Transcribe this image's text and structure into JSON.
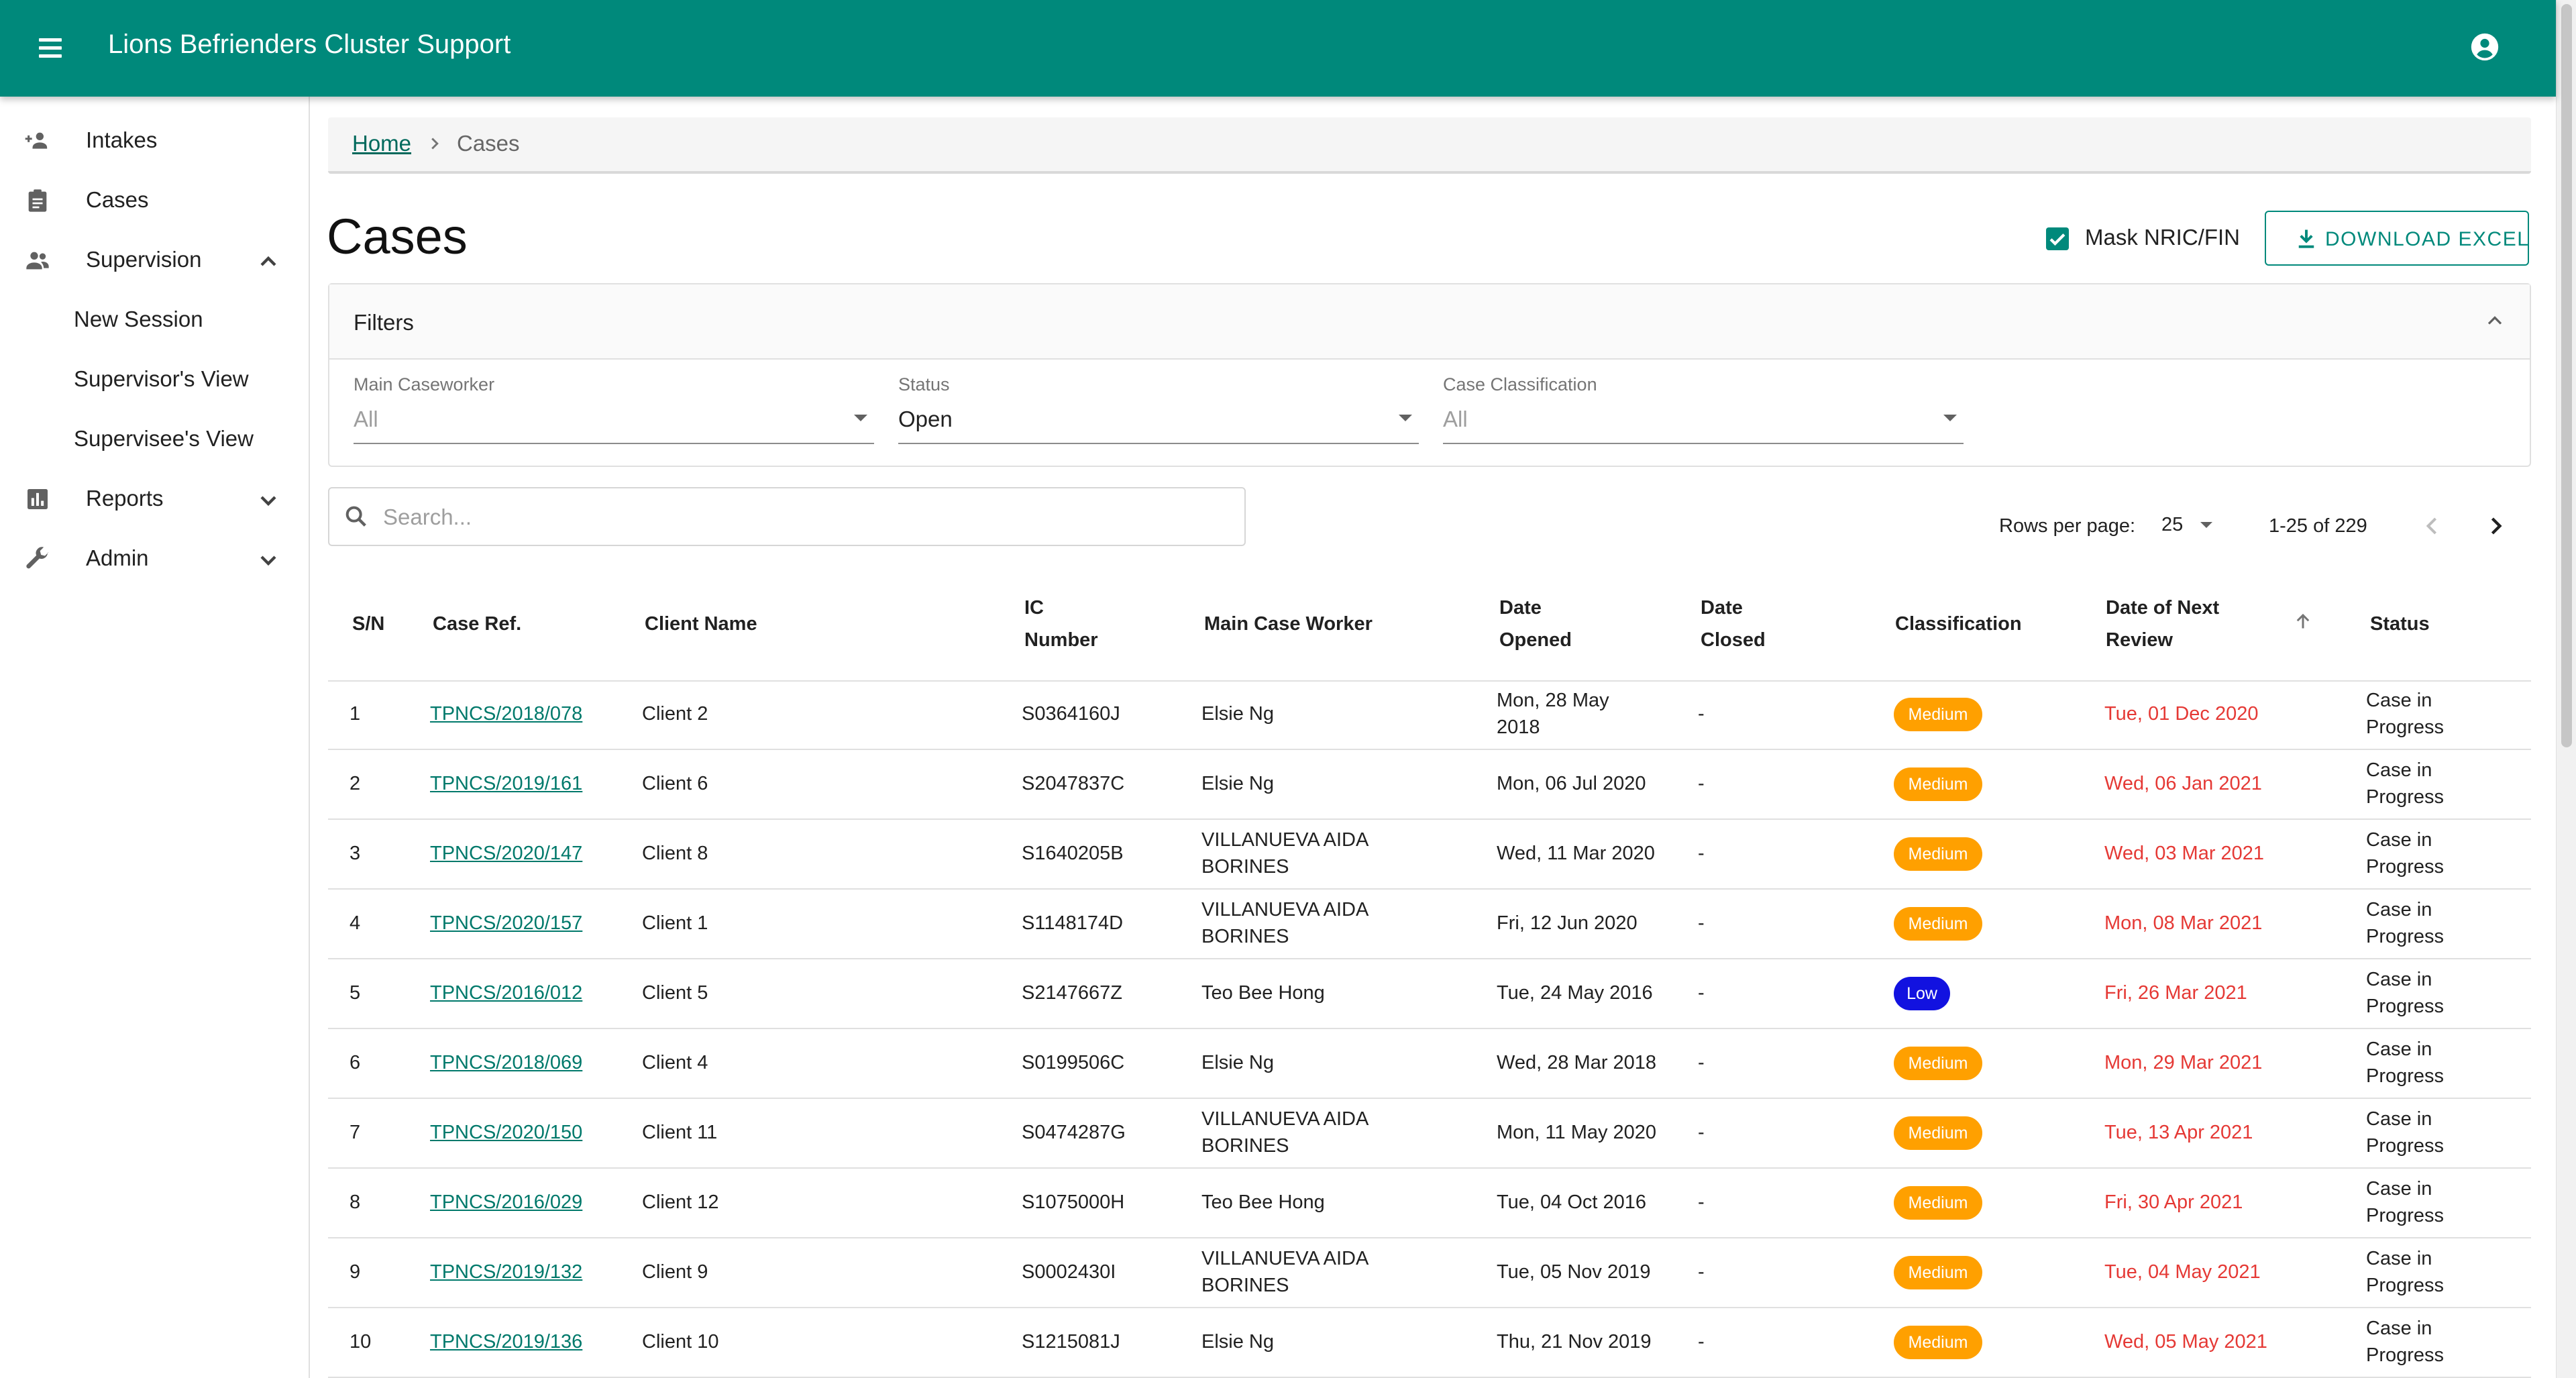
{
  "app": {
    "title": "Lions Befrienders Cluster Support"
  },
  "sidebar": {
    "items": [
      {
        "label": "Intakes",
        "icon": "person-add-icon"
      },
      {
        "label": "Cases",
        "icon": "clipboard-icon"
      },
      {
        "label": "Supervision",
        "icon": "people-icon",
        "expanded": true,
        "children": [
          {
            "label": "New Session"
          },
          {
            "label": "Supervisor's View"
          },
          {
            "label": "Supervisee's View"
          }
        ]
      },
      {
        "label": "Reports",
        "icon": "bar-chart-icon",
        "expanded": false
      },
      {
        "label": "Admin",
        "icon": "wrench-icon",
        "expanded": false
      }
    ]
  },
  "breadcrumb": {
    "home": "Home",
    "current": "Cases"
  },
  "page": {
    "title": "Cases",
    "mask_label": "Mask NRIC/FIN",
    "mask_checked": true,
    "download_label": "DOWNLOAD EXCEL"
  },
  "filters": {
    "title": "Filters",
    "main_caseworker": {
      "label": "Main Caseworker",
      "value": "All"
    },
    "status": {
      "label": "Status",
      "value": "Open"
    },
    "classification": {
      "label": "Case Classification",
      "value": "All"
    }
  },
  "search": {
    "placeholder": "Search..."
  },
  "pagination": {
    "rows_label": "Rows per page:",
    "rows_value": "25",
    "range": "1-25 of 229"
  },
  "colors": {
    "primary": "#00897b",
    "medium": "#ffa000",
    "low": "#1212e0",
    "overdue": "#e53935"
  },
  "table": {
    "headers": {
      "sn": "S/N",
      "case_ref": "Case Ref.",
      "client_name": "Client Name",
      "ic": "IC",
      "ic2": "Number",
      "worker": "Main Case Worker",
      "opened": "Date",
      "opened2": "Opened",
      "closed": "Date",
      "closed2": "Closed",
      "classification": "Classification",
      "review": "Date of Next",
      "review2": "Review",
      "status": "Status"
    },
    "rows": [
      {
        "sn": "1",
        "ref": "TPNCS/2018/078",
        "client": "Client 2",
        "ic": "S0364160J",
        "worker": "Elsie Ng",
        "opened": "Mon, 28 May 2018",
        "closed": "-",
        "class": "Medium",
        "review": "Tue, 01 Dec 2020",
        "status": "Case in Progress"
      },
      {
        "sn": "2",
        "ref": "TPNCS/2019/161",
        "client": "Client 6",
        "ic": "S2047837C",
        "worker": "Elsie Ng",
        "opened": "Mon, 06 Jul 2020",
        "closed": "-",
        "class": "Medium",
        "review": "Wed, 06 Jan 2021",
        "status": "Case in Progress"
      },
      {
        "sn": "3",
        "ref": "TPNCS/2020/147",
        "client": "Client 8",
        "ic": "S1640205B",
        "worker": "VILLANUEVA AIDA BORINES",
        "opened": "Wed, 11 Mar 2020",
        "closed": "-",
        "class": "Medium",
        "review": "Wed, 03 Mar 2021",
        "status": "Case in Progress"
      },
      {
        "sn": "4",
        "ref": "TPNCS/2020/157",
        "client": "Client 1",
        "ic": "S1148174D",
        "worker": "VILLANUEVA AIDA BORINES",
        "opened": "Fri, 12 Jun 2020",
        "closed": "-",
        "class": "Medium",
        "review": "Mon, 08 Mar 2021",
        "status": "Case in Progress"
      },
      {
        "sn": "5",
        "ref": "TPNCS/2016/012",
        "client": "Client 5",
        "ic": "S2147667Z",
        "worker": "Teo Bee Hong",
        "opened": "Tue, 24 May 2016",
        "closed": "-",
        "class": "Low",
        "review": "Fri, 26 Mar 2021",
        "status": "Case in Progress"
      },
      {
        "sn": "6",
        "ref": "TPNCS/2018/069",
        "client": "Client 4",
        "ic": "S0199506C",
        "worker": "Elsie Ng",
        "opened": "Wed, 28 Mar 2018",
        "closed": "-",
        "class": "Medium",
        "review": "Mon, 29 Mar 2021",
        "status": "Case in Progress"
      },
      {
        "sn": "7",
        "ref": "TPNCS/2020/150",
        "client": "Client 11",
        "ic": "S0474287G",
        "worker": "VILLANUEVA AIDA BORINES",
        "opened": "Mon, 11 May 2020",
        "closed": "-",
        "class": "Medium",
        "review": "Tue, 13 Apr 2021",
        "status": "Case in Progress"
      },
      {
        "sn": "8",
        "ref": "TPNCS/2016/029",
        "client": "Client 12",
        "ic": "S1075000H",
        "worker": "Teo Bee Hong",
        "opened": "Tue, 04 Oct 2016",
        "closed": "-",
        "class": "Medium",
        "review": "Fri, 30 Apr 2021",
        "status": "Case in Progress"
      },
      {
        "sn": "9",
        "ref": "TPNCS/2019/132",
        "client": "Client 9",
        "ic": "S0002430I",
        "worker": "VILLANUEVA AIDA BORINES",
        "opened": "Tue, 05 Nov 2019",
        "closed": "-",
        "class": "Medium",
        "review": "Tue, 04 May 2021",
        "status": "Case in Progress"
      },
      {
        "sn": "10",
        "ref": "TPNCS/2019/136",
        "client": "Client 10",
        "ic": "S1215081J",
        "worker": "Elsie Ng",
        "opened": "Thu, 21 Nov 2019",
        "closed": "-",
        "class": "Medium",
        "review": "Wed, 05 May 2021",
        "status": "Case in Progress"
      }
    ]
  }
}
